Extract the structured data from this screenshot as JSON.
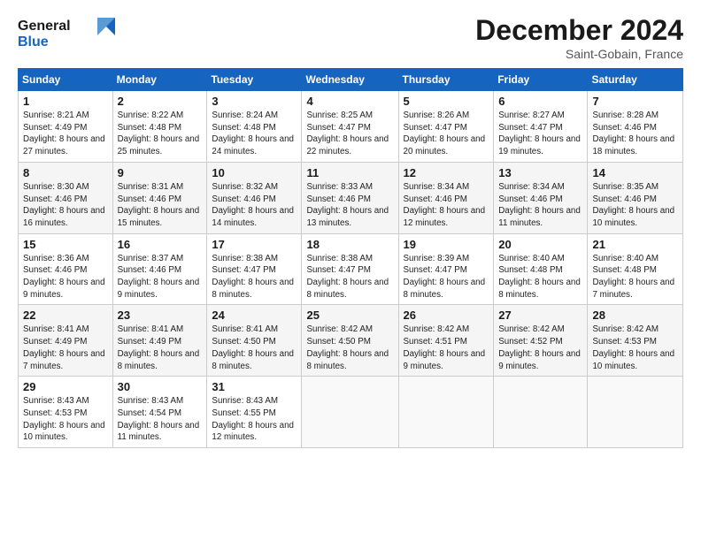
{
  "header": {
    "logo_line1": "General",
    "logo_line2": "Blue",
    "month_title": "December 2024",
    "location": "Saint-Gobain, France"
  },
  "columns": [
    "Sunday",
    "Monday",
    "Tuesday",
    "Wednesday",
    "Thursday",
    "Friday",
    "Saturday"
  ],
  "weeks": [
    [
      {
        "day": "1",
        "sunrise": "8:21 AM",
        "sunset": "4:49 PM",
        "daylight": "8 hours and 27 minutes."
      },
      {
        "day": "2",
        "sunrise": "8:22 AM",
        "sunset": "4:48 PM",
        "daylight": "8 hours and 25 minutes."
      },
      {
        "day": "3",
        "sunrise": "8:24 AM",
        "sunset": "4:48 PM",
        "daylight": "8 hours and 24 minutes."
      },
      {
        "day": "4",
        "sunrise": "8:25 AM",
        "sunset": "4:47 PM",
        "daylight": "8 hours and 22 minutes."
      },
      {
        "day": "5",
        "sunrise": "8:26 AM",
        "sunset": "4:47 PM",
        "daylight": "8 hours and 20 minutes."
      },
      {
        "day": "6",
        "sunrise": "8:27 AM",
        "sunset": "4:47 PM",
        "daylight": "8 hours and 19 minutes."
      },
      {
        "day": "7",
        "sunrise": "8:28 AM",
        "sunset": "4:46 PM",
        "daylight": "8 hours and 18 minutes."
      }
    ],
    [
      {
        "day": "8",
        "sunrise": "8:30 AM",
        "sunset": "4:46 PM",
        "daylight": "8 hours and 16 minutes."
      },
      {
        "day": "9",
        "sunrise": "8:31 AM",
        "sunset": "4:46 PM",
        "daylight": "8 hours and 15 minutes."
      },
      {
        "day": "10",
        "sunrise": "8:32 AM",
        "sunset": "4:46 PM",
        "daylight": "8 hours and 14 minutes."
      },
      {
        "day": "11",
        "sunrise": "8:33 AM",
        "sunset": "4:46 PM",
        "daylight": "8 hours and 13 minutes."
      },
      {
        "day": "12",
        "sunrise": "8:34 AM",
        "sunset": "4:46 PM",
        "daylight": "8 hours and 12 minutes."
      },
      {
        "day": "13",
        "sunrise": "8:34 AM",
        "sunset": "4:46 PM",
        "daylight": "8 hours and 11 minutes."
      },
      {
        "day": "14",
        "sunrise": "8:35 AM",
        "sunset": "4:46 PM",
        "daylight": "8 hours and 10 minutes."
      }
    ],
    [
      {
        "day": "15",
        "sunrise": "8:36 AM",
        "sunset": "4:46 PM",
        "daylight": "8 hours and 9 minutes."
      },
      {
        "day": "16",
        "sunrise": "8:37 AM",
        "sunset": "4:46 PM",
        "daylight": "8 hours and 9 minutes."
      },
      {
        "day": "17",
        "sunrise": "8:38 AM",
        "sunset": "4:47 PM",
        "daylight": "8 hours and 8 minutes."
      },
      {
        "day": "18",
        "sunrise": "8:38 AM",
        "sunset": "4:47 PM",
        "daylight": "8 hours and 8 minutes."
      },
      {
        "day": "19",
        "sunrise": "8:39 AM",
        "sunset": "4:47 PM",
        "daylight": "8 hours and 8 minutes."
      },
      {
        "day": "20",
        "sunrise": "8:40 AM",
        "sunset": "4:48 PM",
        "daylight": "8 hours and 8 minutes."
      },
      {
        "day": "21",
        "sunrise": "8:40 AM",
        "sunset": "4:48 PM",
        "daylight": "8 hours and 7 minutes."
      }
    ],
    [
      {
        "day": "22",
        "sunrise": "8:41 AM",
        "sunset": "4:49 PM",
        "daylight": "8 hours and 7 minutes."
      },
      {
        "day": "23",
        "sunrise": "8:41 AM",
        "sunset": "4:49 PM",
        "daylight": "8 hours and 8 minutes."
      },
      {
        "day": "24",
        "sunrise": "8:41 AM",
        "sunset": "4:50 PM",
        "daylight": "8 hours and 8 minutes."
      },
      {
        "day": "25",
        "sunrise": "8:42 AM",
        "sunset": "4:50 PM",
        "daylight": "8 hours and 8 minutes."
      },
      {
        "day": "26",
        "sunrise": "8:42 AM",
        "sunset": "4:51 PM",
        "daylight": "8 hours and 9 minutes."
      },
      {
        "day": "27",
        "sunrise": "8:42 AM",
        "sunset": "4:52 PM",
        "daylight": "8 hours and 9 minutes."
      },
      {
        "day": "28",
        "sunrise": "8:42 AM",
        "sunset": "4:53 PM",
        "daylight": "8 hours and 10 minutes."
      }
    ],
    [
      {
        "day": "29",
        "sunrise": "8:43 AM",
        "sunset": "4:53 PM",
        "daylight": "8 hours and 10 minutes."
      },
      {
        "day": "30",
        "sunrise": "8:43 AM",
        "sunset": "4:54 PM",
        "daylight": "8 hours and 11 minutes."
      },
      {
        "day": "31",
        "sunrise": "8:43 AM",
        "sunset": "4:55 PM",
        "daylight": "8 hours and 12 minutes."
      },
      null,
      null,
      null,
      null
    ]
  ],
  "labels": {
    "sunrise_prefix": "Sunrise: ",
    "sunset_prefix": "Sunset: ",
    "daylight_prefix": "Daylight: "
  }
}
